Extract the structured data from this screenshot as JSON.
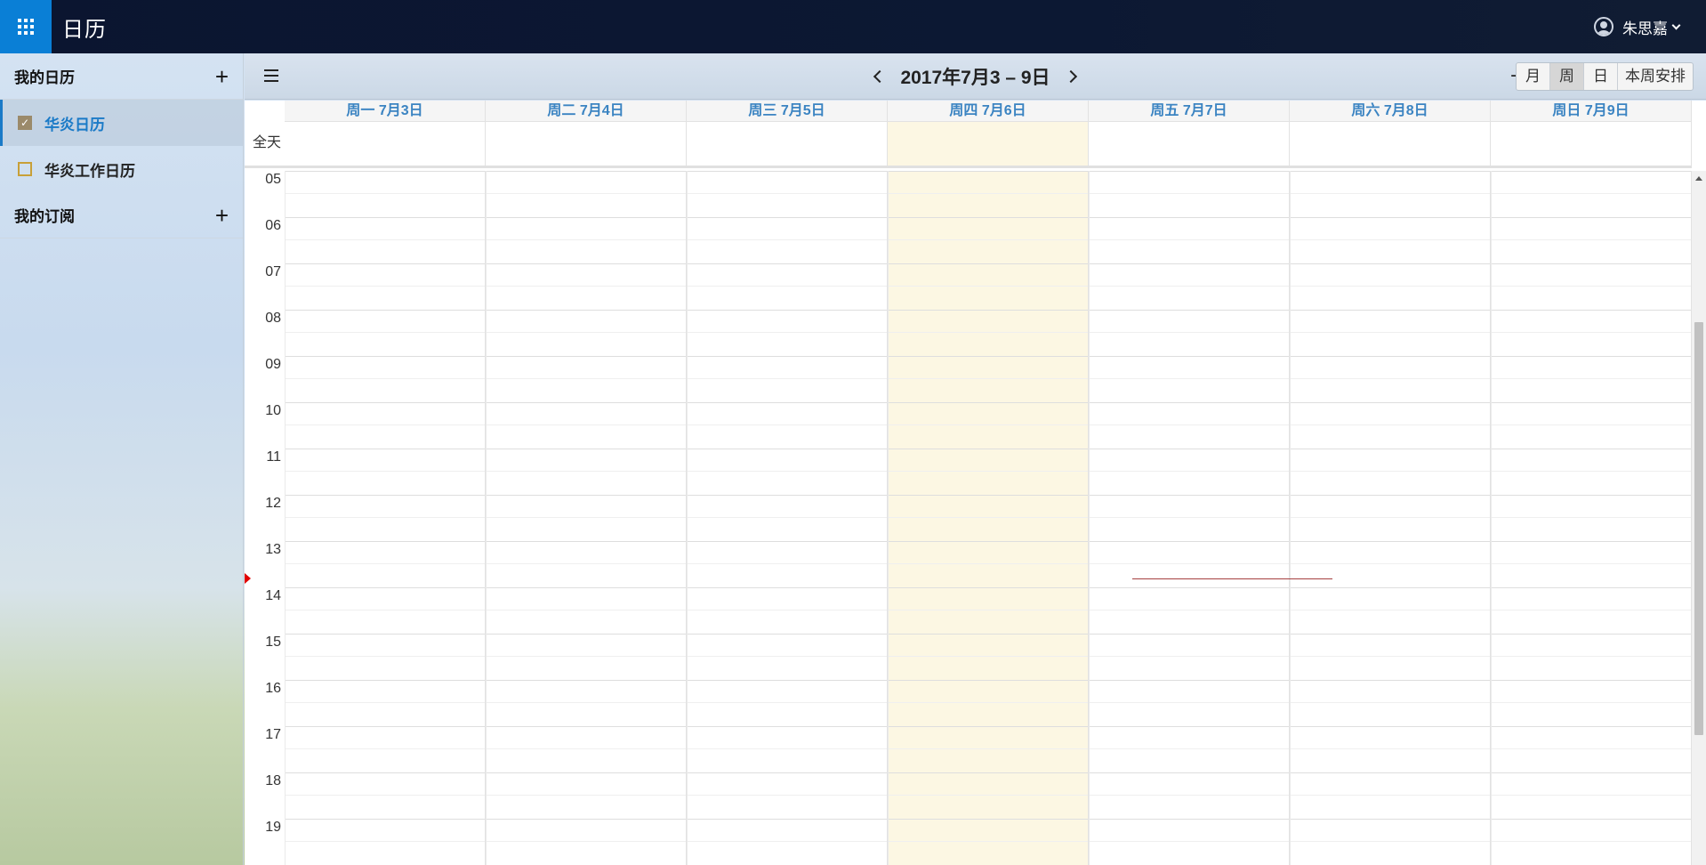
{
  "app": {
    "title": "日历"
  },
  "user": {
    "name": "朱思嘉"
  },
  "sidebar": {
    "my_calendars_label": "我的日历",
    "calendars": [
      {
        "label": "华炎日历",
        "checked": true
      },
      {
        "label": "华炎工作日历",
        "checked": false
      }
    ],
    "subscriptions_label": "我的订阅"
  },
  "toolbar": {
    "range_title": "2017年7月3 – 9日",
    "views": [
      "月",
      "周",
      "日",
      "本周安排"
    ],
    "active_view": "周"
  },
  "calendar": {
    "allday_label": "全天",
    "days": [
      "周一 7月3日",
      "周二 7月4日",
      "周三 7月5日",
      "周四 7月6日",
      "周五 7月7日",
      "周六 7月8日",
      "周日 7月9日"
    ],
    "today_index": 3,
    "hours": [
      "05",
      "06",
      "07",
      "08",
      "09",
      "10",
      "11",
      "12",
      "13",
      "14",
      "15",
      "16",
      "17",
      "18",
      "19"
    ]
  },
  "colors": {
    "accent": "#1a7ac7",
    "today_bg": "#fcf7e3",
    "now_line": "#a64040",
    "topbar": "#0b1530",
    "launcher": "#0a7fd6"
  }
}
